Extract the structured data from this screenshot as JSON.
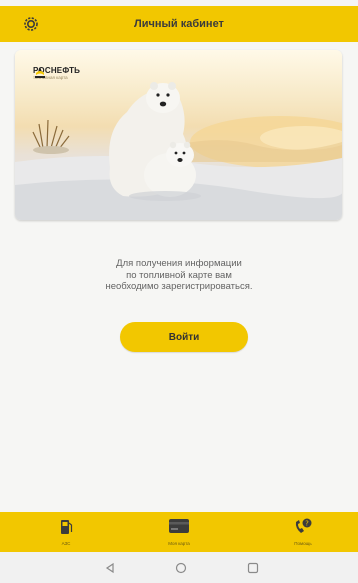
{
  "header": {
    "title": "Личный кабинет",
    "settings_icon": "gear-icon"
  },
  "card": {
    "brand_name": "РОСНЕФТЬ",
    "brand_sub": "топливная карта"
  },
  "main": {
    "info_lines": [
      "Для получения информации",
      "по топливной карте вам",
      "необходимо зарегистрироваться."
    ],
    "login_label": "Войти"
  },
  "bottom_nav": {
    "items": [
      {
        "label": "АЗС",
        "icon": "fuel-pump-icon"
      },
      {
        "label": "Моя карта",
        "icon": "card-icon"
      },
      {
        "label": "Помощь",
        "icon": "support-icon"
      }
    ]
  },
  "system_nav": {
    "buttons": [
      "back-icon",
      "home-icon",
      "recents-icon"
    ]
  },
  "colors": {
    "accent": "#f2c700",
    "background": "#f6f6f4",
    "text": "#646464"
  }
}
